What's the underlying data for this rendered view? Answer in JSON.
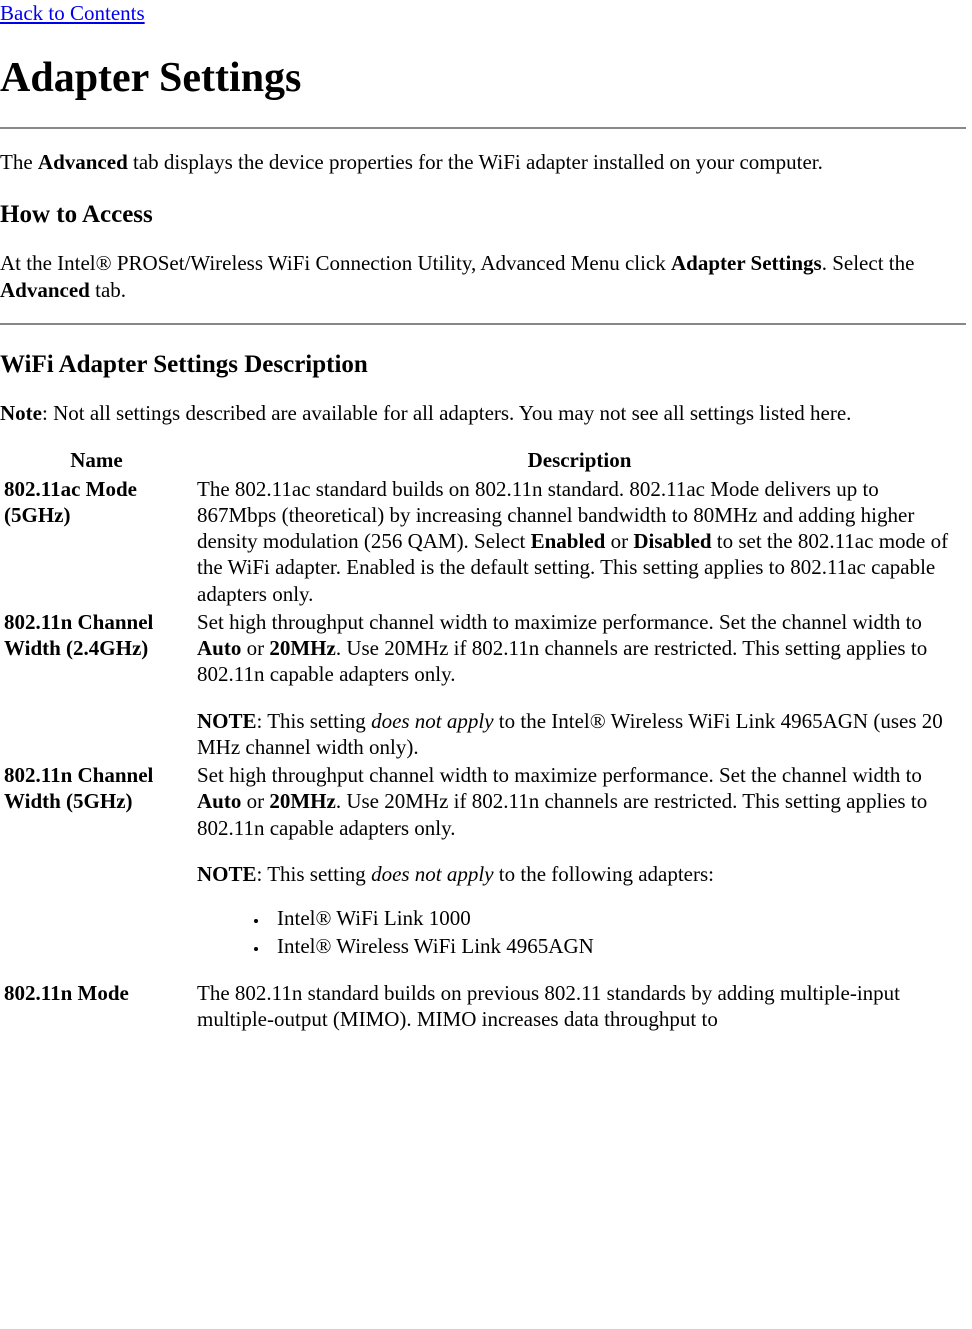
{
  "back_link": "Back to Contents",
  "page_title": "Adapter Settings",
  "intro": {
    "pre": "The ",
    "bold1": "Advanced",
    "post": " tab displays the device properties for the WiFi adapter installed on your computer."
  },
  "how_to_access": {
    "heading": "How to Access",
    "pre": "At the Intel® PROSet/Wireless WiFi Connection Utility, Advanced Menu click ",
    "bold1": "Adapter Settings",
    "mid": ". Select the ",
    "bold2": "Advanced",
    "post": " tab."
  },
  "settings_desc": {
    "heading": "WiFi Adapter Settings Description",
    "note_label": "Note",
    "note_text": ": Not all settings described are available for all adapters. You may not see all settings listed here."
  },
  "table": {
    "header_name": "Name",
    "header_desc": "Description",
    "rows": {
      "ac_mode": {
        "name": "802.11ac Mode (5GHz)",
        "p1a": "The 802.11ac standard builds on 802.11n standard. 802.11ac Mode delivers up to 867Mbps (theoretical) by increasing channel bandwidth to 80MHz and adding higher density modulation (256 QAM). Select ",
        "b1": "Enabled",
        "p1b": " or ",
        "b2": "Disabled",
        "p1c": " to set the 802.11ac mode of the WiFi adapter. Enabled is the default setting. This setting applies to 802.11ac capable adapters only."
      },
      "n_24": {
        "name": "802.11n Channel Width (2.4GHz)",
        "p1a": "Set high throughput channel width to maximize performance. Set the channel width to ",
        "b1": "Auto",
        "p1b": " or ",
        "b2": "20MHz",
        "p1c": ". Use 20MHz if 802.11n channels are restricted. This setting applies to 802.11n capable adapters only.",
        "note_b": "NOTE",
        "note_a": ": This setting ",
        "note_i": "does not apply",
        "note_c": " to the Intel® Wireless WiFi Link 4965AGN (uses 20 MHz channel width only)."
      },
      "n_5": {
        "name": "802.11n Channel Width (5GHz)",
        "p1a": "Set high throughput channel width to maximize performance. Set the channel width to ",
        "b1": "Auto",
        "p1b": " or ",
        "b2": "20MHz",
        "p1c": ". Use 20MHz if 802.11n channels are restricted. This setting applies to 802.11n capable adapters only.",
        "note_b": "NOTE",
        "note_a": ": This setting ",
        "note_i": "does not apply",
        "note_c": " to the following adapters:",
        "li1": "Intel® WiFi Link 1000",
        "li2": "Intel® Wireless WiFi Link 4965AGN"
      },
      "n_mode": {
        "name": "802.11n Mode",
        "p1": "The 802.11n standard builds on previous 802.11 standards by adding multiple-input multiple-output (MIMO). MIMO increases data throughput to"
      }
    }
  }
}
